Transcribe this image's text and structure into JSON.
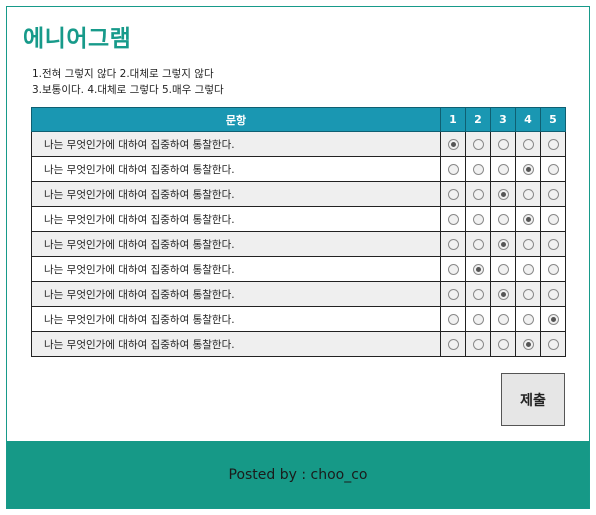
{
  "title": "에니어그램",
  "legend": {
    "line1": "1.전혀 그렇지 않다 2.대체로 그렇지 않다",
    "line2": "3.보통이다. 4.대체로 그렇다 5.매우 그렇다"
  },
  "table": {
    "header": {
      "question": "문항",
      "options": [
        "1",
        "2",
        "3",
        "4",
        "5"
      ]
    },
    "rows": [
      {
        "text": "나는 무엇인가에 대하여 집중하여 통찰한다.",
        "selected": 1
      },
      {
        "text": "나는 무엇인가에 대하여 집중하여 통찰한다.",
        "selected": 4
      },
      {
        "text": "나는 무엇인가에 대하여 집중하여 통찰한다.",
        "selected": 3
      },
      {
        "text": "나는 무엇인가에 대하여 집중하여 통찰한다.",
        "selected": 4
      },
      {
        "text": "나는 무엇인가에 대하여 집중하여 통찰한다.",
        "selected": 3
      },
      {
        "text": "나는 무엇인가에 대하여 집중하여 통찰한다.",
        "selected": 2
      },
      {
        "text": "나는 무엇인가에 대하여 집중하여 통찰한다.",
        "selected": 3
      },
      {
        "text": "나는 무엇인가에 대하여 집중하여 통찰한다.",
        "selected": 5
      },
      {
        "text": "나는 무엇인가에 대하여 집중하여 통찰한다.",
        "selected": 4
      }
    ]
  },
  "submit_label": "제출",
  "footer_text": "Posted by : choo_co",
  "colors": {
    "accent": "#179a8a",
    "header_bg": "#1a97b2",
    "footer_bg": "#169987",
    "row_alt": "#efefef"
  }
}
